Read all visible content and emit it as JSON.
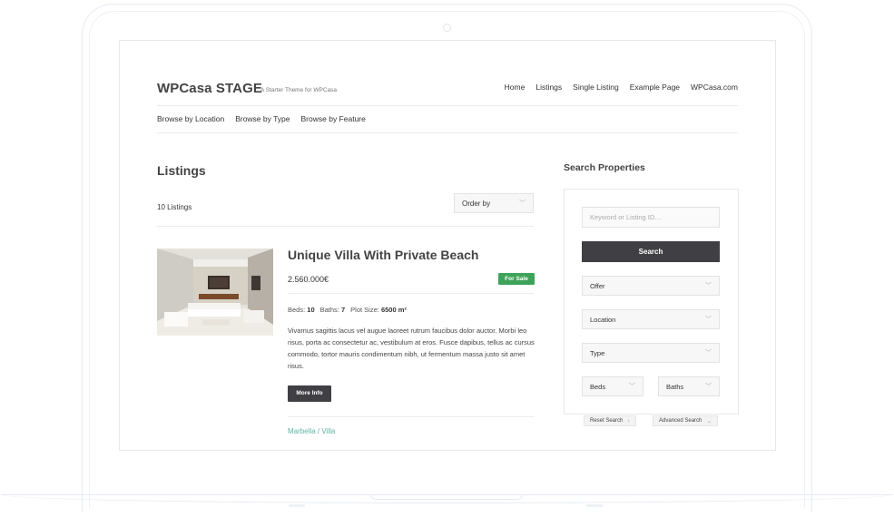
{
  "site": {
    "title": "WPCasa STAGE",
    "tagline": "A Starter Theme for WPCasa"
  },
  "main_nav": [
    "Home",
    "Listings",
    "Single Listing",
    "Example Page",
    "WPCasa.com"
  ],
  "sub_nav": [
    "Browse by Location",
    "Browse by Type",
    "Browse by Feature"
  ],
  "listings_page": {
    "title": "Listings",
    "count_text": "10 Listings",
    "order_by_label": "Order by"
  },
  "listing": {
    "title": "Unique Villa With Private Beach",
    "price": "2.560.000€",
    "status_badge": "For Sale",
    "beds_label": "Beds:",
    "beds_value": "10",
    "baths_label": "Baths:",
    "baths_value": "7",
    "plot_label": "Plot Size:",
    "plot_value": "6500 m²",
    "excerpt": "Vivamus sagittis lacus vel augue laoreet rutrum faucibus dolor auctor. Morbi leo risus, porta ac consectetur ac, vestibulum at eros. Fusce dapibus, tellus ac cursus commodo, tortor mauris condimentum nibh, ut fermentum massa justo sit amet risus.",
    "more_info_label": "More Info",
    "term_location": "Marbella",
    "term_separator": " / ",
    "term_type": "Villa"
  },
  "search": {
    "title": "Search Properties",
    "keyword_placeholder": "Keyword or Listing ID…",
    "search_button": "Search",
    "offer_label": "Offer",
    "location_label": "Location",
    "type_label": "Type",
    "beds_label": "Beds",
    "baths_label": "Baths",
    "reset_label": "Reset Search",
    "advanced_label": "Advanced Search"
  },
  "colors": {
    "accent_green": "#3ea35a",
    "term_link": "#5fb5a5",
    "dark_button": "#404044"
  }
}
